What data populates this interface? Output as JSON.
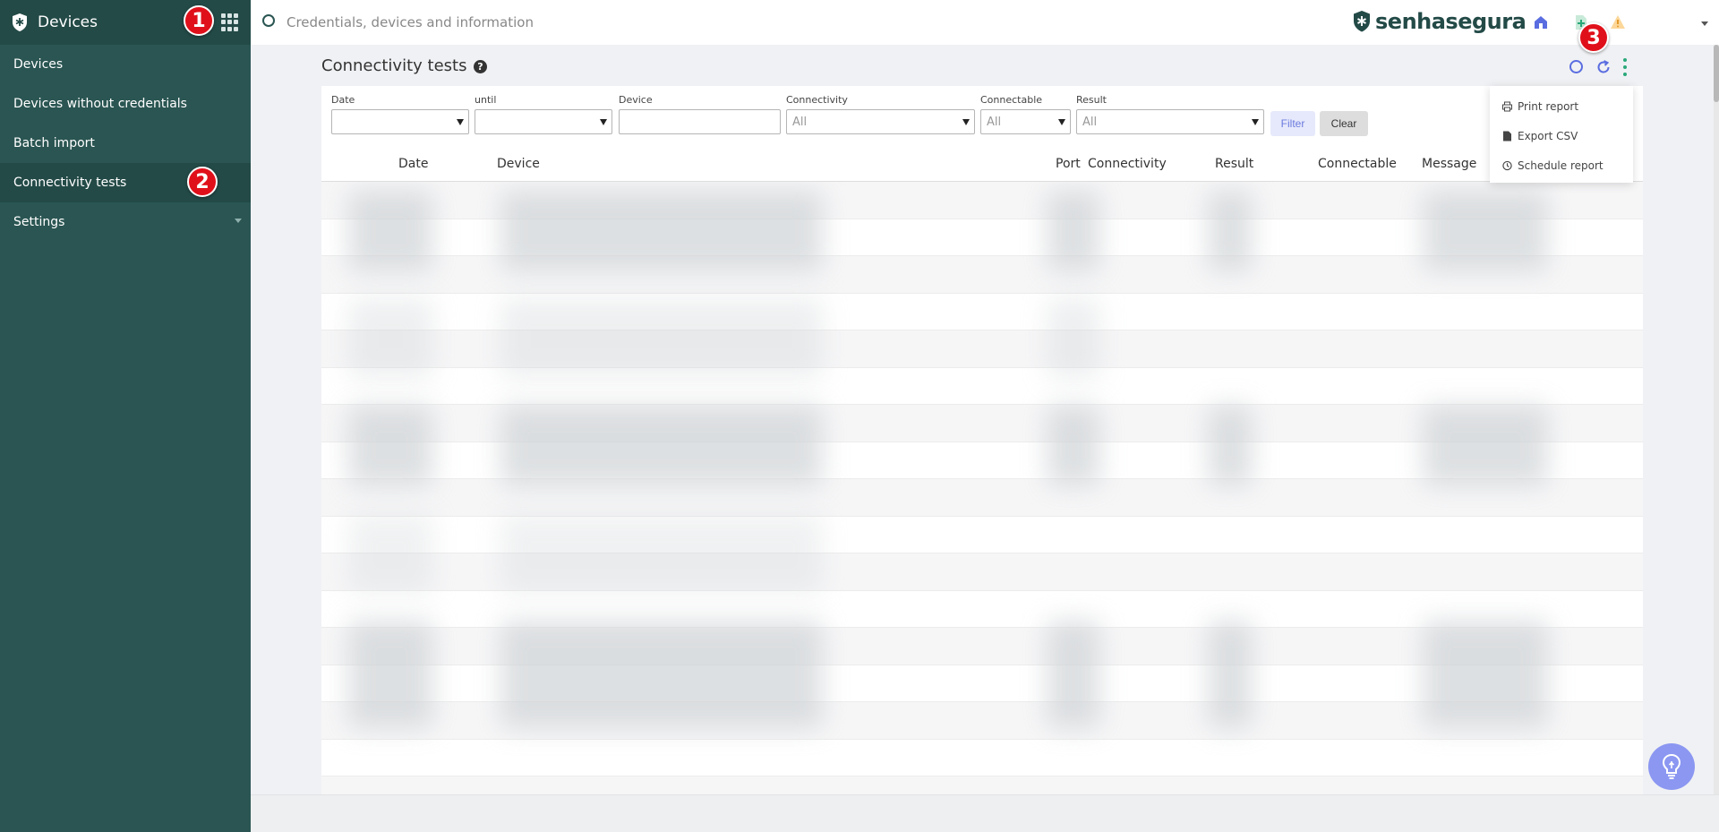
{
  "sidebar": {
    "title": "Devices",
    "items": [
      {
        "label": "Devices"
      },
      {
        "label": "Devices without credentials"
      },
      {
        "label": "Batch import"
      },
      {
        "label": "Connectivity tests"
      },
      {
        "label": "Settings"
      }
    ],
    "active": "Connectivity tests"
  },
  "topbar": {
    "search_placeholder": "Credentials, devices and information",
    "brand": "senhasegura",
    "icons": [
      "home-icon",
      "add-document-icon",
      "warning-icon"
    ]
  },
  "page": {
    "title": "Connectivity tests"
  },
  "filters": {
    "date_label": "Date",
    "until_label": "until",
    "device_label": "Device",
    "connectivity_label": "Connectivity",
    "connectivity_value": "All",
    "connectable_label": "Connectable",
    "connectable_value": "All",
    "result_label": "Result",
    "result_value": "All",
    "filter_button": "Filter",
    "clear_button": "Clear"
  },
  "table": {
    "columns": [
      "Date",
      "Device",
      "Port",
      "Connectivity",
      "Result",
      "Connectable",
      "Message"
    ]
  },
  "menu": {
    "items": [
      {
        "label": "Print report",
        "icon": "printer-icon"
      },
      {
        "label": "Export CSV",
        "icon": "file-icon"
      },
      {
        "label": "Schedule report",
        "icon": "clock-icon"
      }
    ]
  },
  "annotations": [
    "1",
    "2",
    "3"
  ],
  "colors": {
    "sidebar_bg": "#2a5552",
    "sidebar_header_bg": "#234a47",
    "accent_blue": "#5a6de0",
    "accent_green": "#29a87a",
    "badge_red": "#e0101a"
  }
}
